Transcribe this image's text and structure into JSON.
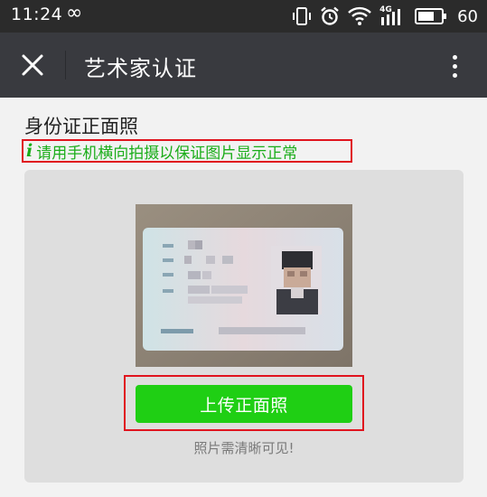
{
  "status_bar": {
    "time": "11:24",
    "infinity_symbol": "∞",
    "network_label": "4G",
    "battery_level": "60",
    "icons": [
      "vibrate-icon",
      "alarm-icon",
      "wifi-icon",
      "signal-icon",
      "battery-icon"
    ]
  },
  "app_bar": {
    "title": "艺术家认证",
    "close_icon": "close-icon",
    "more_icon": "more-vertical-icon"
  },
  "main": {
    "section_title": "身份证正面照",
    "tip_icon_glyph": "i",
    "tip_text": "请用手机横向拍摄以保证图片显示正常",
    "upload_button_label": "上传正面照",
    "hint_text": "照片需清晰可见!"
  },
  "colors": {
    "status_bar_bg": "#2b2b2b",
    "app_bar_bg": "#393a3f",
    "page_bg": "#f2f2f2",
    "card_bg": "#dedede",
    "accent_green": "#1fcf14",
    "tip_green": "#1aad19",
    "highlight_red": "#e0141e"
  }
}
